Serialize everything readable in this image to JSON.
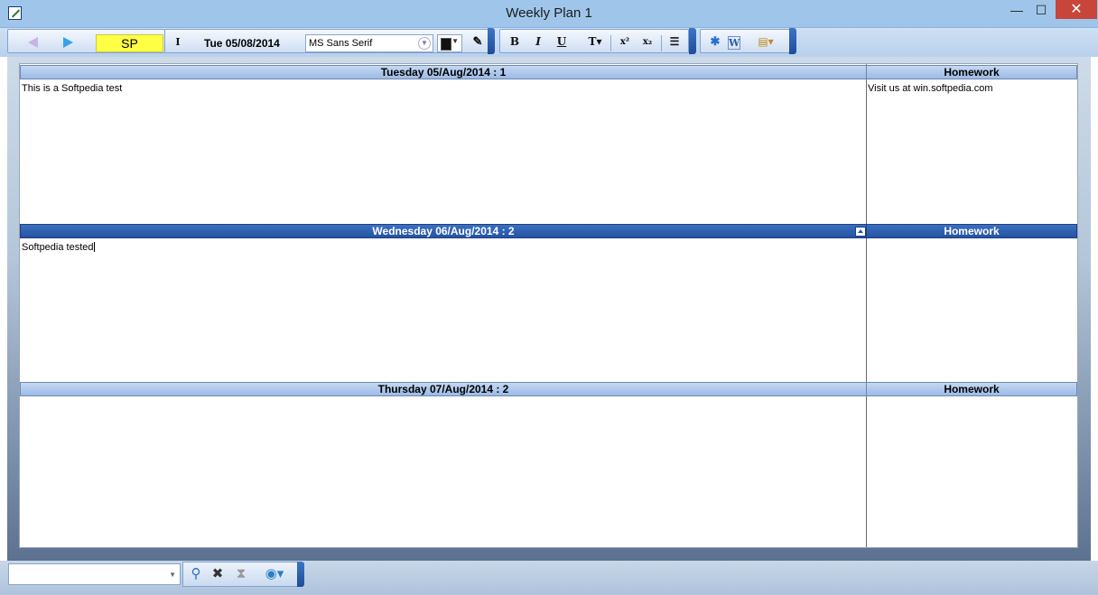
{
  "window": {
    "title": "Weekly Plan 1",
    "minimize": "—",
    "maximize": "☐",
    "close": "✕"
  },
  "toolbar": {
    "user_badge": "SP",
    "badge_color": "#ffff44",
    "date": "Tue 05/08/2014",
    "font_name": "MS Sans Serif",
    "text_color": "#111111",
    "format": {
      "bold": "B",
      "italic": "I",
      "underline": "U",
      "text_style": "T▾",
      "superscript": "x²",
      "subscript": "x₂",
      "list": "☰"
    }
  },
  "days": [
    {
      "header": "Tuesday 05/Aug/2014 : 1",
      "homework_header": "Homework",
      "content": "This is a Softpedia test",
      "homework": "Visit us at win.softpedia.com"
    },
    {
      "header": "Wednesday 06/Aug/2014 : 2",
      "homework_header": "Homework",
      "content": "Softpedia tested",
      "homework": ""
    },
    {
      "header": "Thursday 07/Aug/2014 : 2",
      "homework_header": "Homework",
      "content": "",
      "homework": ""
    }
  ],
  "bottom": {
    "search_value": ""
  },
  "colors": {
    "header_light": "#9bbbe6",
    "header_dark": "#2553a3",
    "title_bar": "#9fc6ea",
    "close_button": "#c7453a"
  }
}
